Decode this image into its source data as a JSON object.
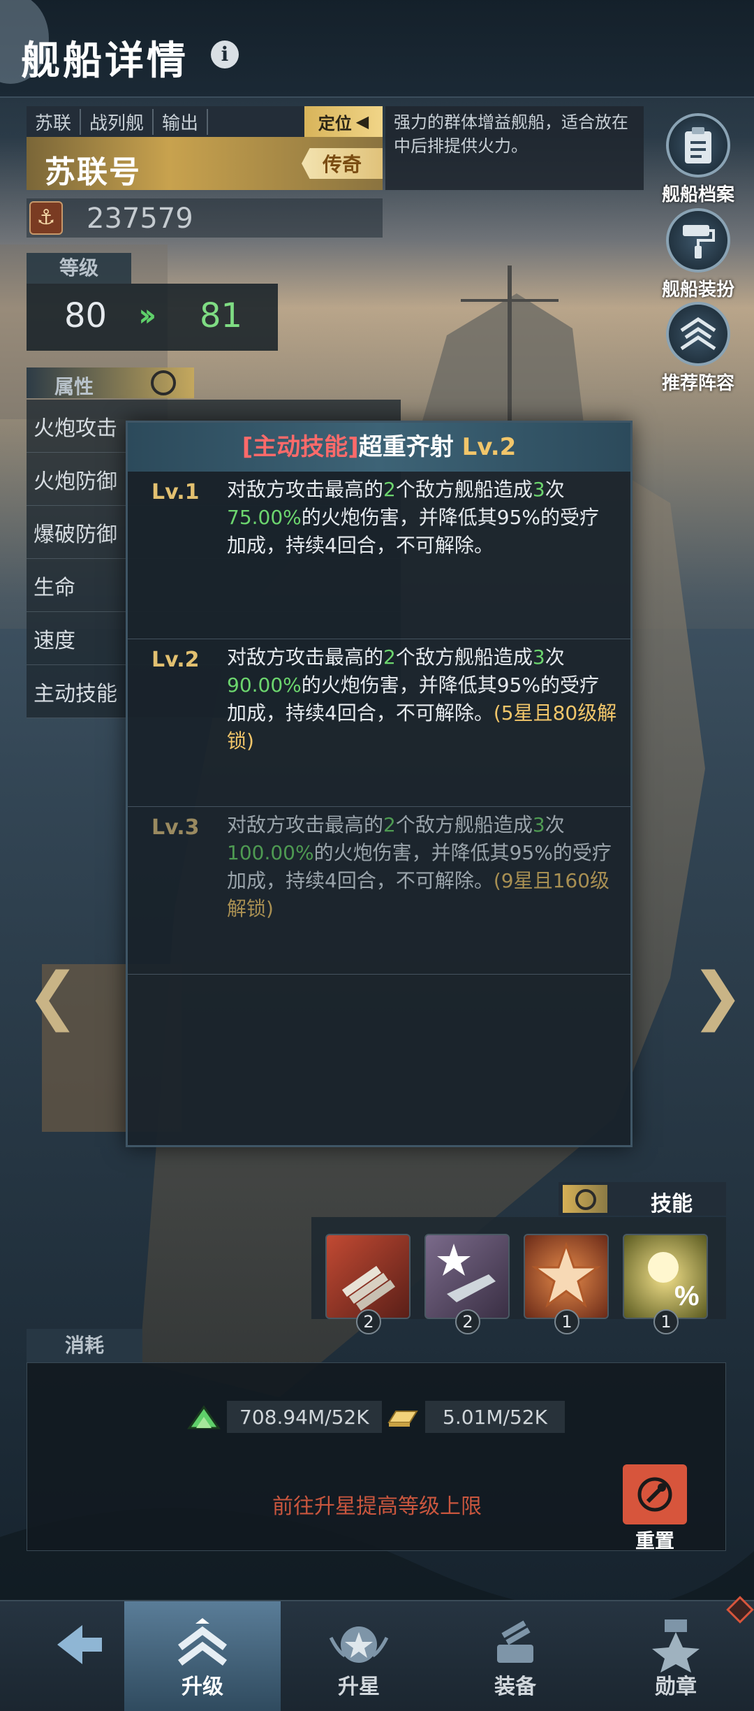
{
  "header": {
    "title": "舰船详情",
    "info_icon": "i"
  },
  "ship": {
    "tags": [
      "苏联",
      "战列舰",
      "输出"
    ],
    "locate_label": "定位",
    "name": "苏联号",
    "rarity": "传奇",
    "description": "强力的群体增益舰船，适合放在中后排提供火力。",
    "power": "237579"
  },
  "level": {
    "label": "等级",
    "current": "80",
    "next": "81"
  },
  "attributes": {
    "label": "属性",
    "items": [
      "火炮攻击",
      "火炮防御",
      "爆破防御",
      "生命",
      "速度",
      "主动技能"
    ]
  },
  "side_buttons": [
    "舰船档案",
    "舰船装扮",
    "推荐阵容"
  ],
  "nav_arrows": {
    "left": "❮",
    "right": "❯"
  },
  "skill_popup": {
    "title_tag": "[主动技能]",
    "title_name": "超重齐射",
    "title_level": "Lv.2",
    "levels": [
      {
        "label": "Lv.1",
        "t1": "对敌方攻击最高的",
        "n1": "2",
        "t2": "个敌方舰船造成",
        "n2": "3",
        "t3": "次",
        "pct": "75.00%",
        "t4": "的火炮伤害，并降低其95%的受疗加成，持续4回合，不可解除。",
        "unlock": ""
      },
      {
        "label": "Lv.2",
        "t1": "对敌方攻击最高的",
        "n1": "2",
        "t2": "个敌方舰船造成",
        "n2": "3",
        "t3": "次",
        "pct": "90.00%",
        "t4": "的火炮伤害，并降低其95%的受疗加成，持续4回合，不可解除。",
        "unlock": "(5星且80级解锁)"
      },
      {
        "label": "Lv.3",
        "t1": "对敌方攻击最高的",
        "n1": "2",
        "t2": "个敌方舰船造成",
        "n2": "3",
        "t3": "次",
        "pct": "100.00%",
        "t4": "的火炮伤害，并降低其95%的受疗加成，持续4回合，不可解除。",
        "unlock": "(9星且160级解锁)"
      }
    ]
  },
  "skills": {
    "label": "技能",
    "slots": [
      {
        "icon": "artillery-icon",
        "count": "2",
        "color": "#8a3428"
      },
      {
        "icon": "battleship-star-icon",
        "count": "2",
        "color": "#5a4a6a"
      },
      {
        "icon": "star-burst-icon",
        "count": "1",
        "color": "#9a4a2a"
      },
      {
        "icon": "percent-burst-icon",
        "count": "1",
        "color": "#6a6a2a"
      }
    ]
  },
  "consumption": {
    "label": "消耗",
    "costs": [
      {
        "icon": "exp-arrow-icon",
        "value": "708.94M/52K"
      },
      {
        "icon": "gold-bar-icon",
        "value": "5.01M/52K"
      }
    ],
    "goto_text": "前往升星提高等级上限",
    "reset_label": "重置"
  },
  "bottom_nav": {
    "items": [
      {
        "label": "",
        "icon": "back-arrow-icon"
      },
      {
        "label": "升级",
        "icon": "chevron-up-icon"
      },
      {
        "label": "升星",
        "icon": "star-wings-icon"
      },
      {
        "label": "装备",
        "icon": "turret-icon"
      },
      {
        "label": "勋章",
        "icon": "medal-icon"
      }
    ]
  },
  "colors": {
    "accent_gold": "#f2c66a",
    "green": "#6cd56e",
    "red": "#d7553c"
  }
}
